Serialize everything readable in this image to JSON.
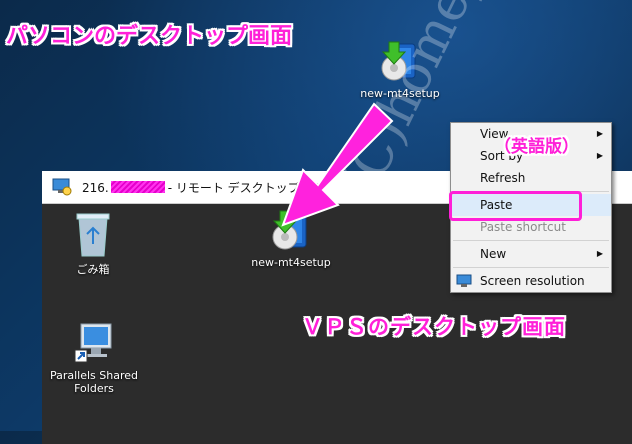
{
  "annotations": {
    "pc_desktop_label": "パソコンのデスクトップ画面",
    "vps_desktop_label": "ＶＰＳのデスクトップ画面",
    "english_version_label": "（英語版）",
    "watermark": "(C)homepage"
  },
  "pc_desktop": {
    "icons": [
      {
        "label": "new-mt4setup",
        "icon": "installer-icon"
      }
    ]
  },
  "remote_window": {
    "title_ip": "216.",
    "title_text": "- リモート デスクトップ接続",
    "desktop_icons": [
      {
        "label": "ごみ箱",
        "icon": "recycle-bin-icon"
      },
      {
        "label": "new-mt4setup",
        "icon": "installer-icon"
      },
      {
        "label": "Parallels Shared Folders",
        "icon": "shared-folder-icon"
      }
    ]
  },
  "context_menu": {
    "items": [
      {
        "label": "View",
        "has_submenu": true
      },
      {
        "label": "Sort by",
        "has_submenu": true
      },
      {
        "label": "Refresh",
        "has_submenu": false
      },
      {
        "label": "Paste",
        "has_submenu": false
      },
      {
        "label": "Paste shortcut",
        "has_submenu": false,
        "disabled": true
      },
      {
        "label": "New",
        "has_submenu": true
      },
      {
        "label": "Screen resolution",
        "has_submenu": false
      }
    ],
    "highlighted": "Paste"
  },
  "colors": {
    "annotation": "#ff1fd8",
    "desktop_bg": "#0d3a68",
    "vps_bg": "#2c2c2c"
  }
}
